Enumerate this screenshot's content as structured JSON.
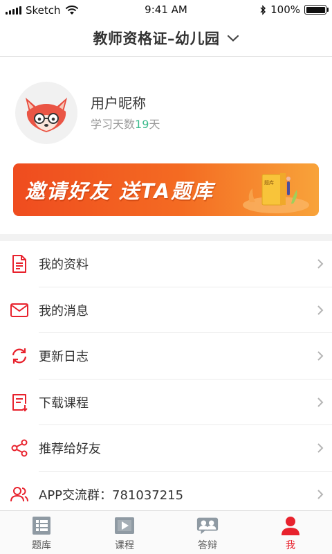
{
  "status_bar": {
    "carrier": "Sketch",
    "time": "9:41 AM",
    "battery": "100%",
    "battery_level": 1.0
  },
  "header": {
    "title": "教师资格证–幼儿园",
    "dropdown_icon": "chevron-down-icon"
  },
  "profile": {
    "nickname": "用户昵称",
    "study_days_prefix": "学习天数",
    "study_days": "19",
    "study_days_suffix": "天",
    "avatar_icon": "fox-avatar-icon"
  },
  "banner": {
    "text": "邀请好友 送TA题库",
    "book_text": "题库",
    "accent_color": "#f05a22"
  },
  "menu": {
    "items": [
      {
        "label": "我的资料",
        "icon": "document-icon"
      },
      {
        "label": "我的消息",
        "icon": "mail-icon"
      },
      {
        "label": "更新日志",
        "icon": "refresh-icon"
      },
      {
        "label": "下载课程",
        "icon": "download-icon"
      },
      {
        "label": "推荐给好友",
        "icon": "share-icon"
      },
      {
        "label": "APP交流群：781037215",
        "icon": "group-icon"
      }
    ]
  },
  "tabs": [
    {
      "label": "题库",
      "icon": "question-bank-icon",
      "active": false
    },
    {
      "label": "课程",
      "icon": "video-icon",
      "active": false
    },
    {
      "label": "答辩",
      "icon": "discussion-icon",
      "active": false
    },
    {
      "label": "我",
      "icon": "user-icon",
      "active": true
    }
  ],
  "colors": {
    "accent": "#e8222d",
    "highlight_number": "#3cba8c",
    "inactive_tab": "#8f9aa3"
  }
}
